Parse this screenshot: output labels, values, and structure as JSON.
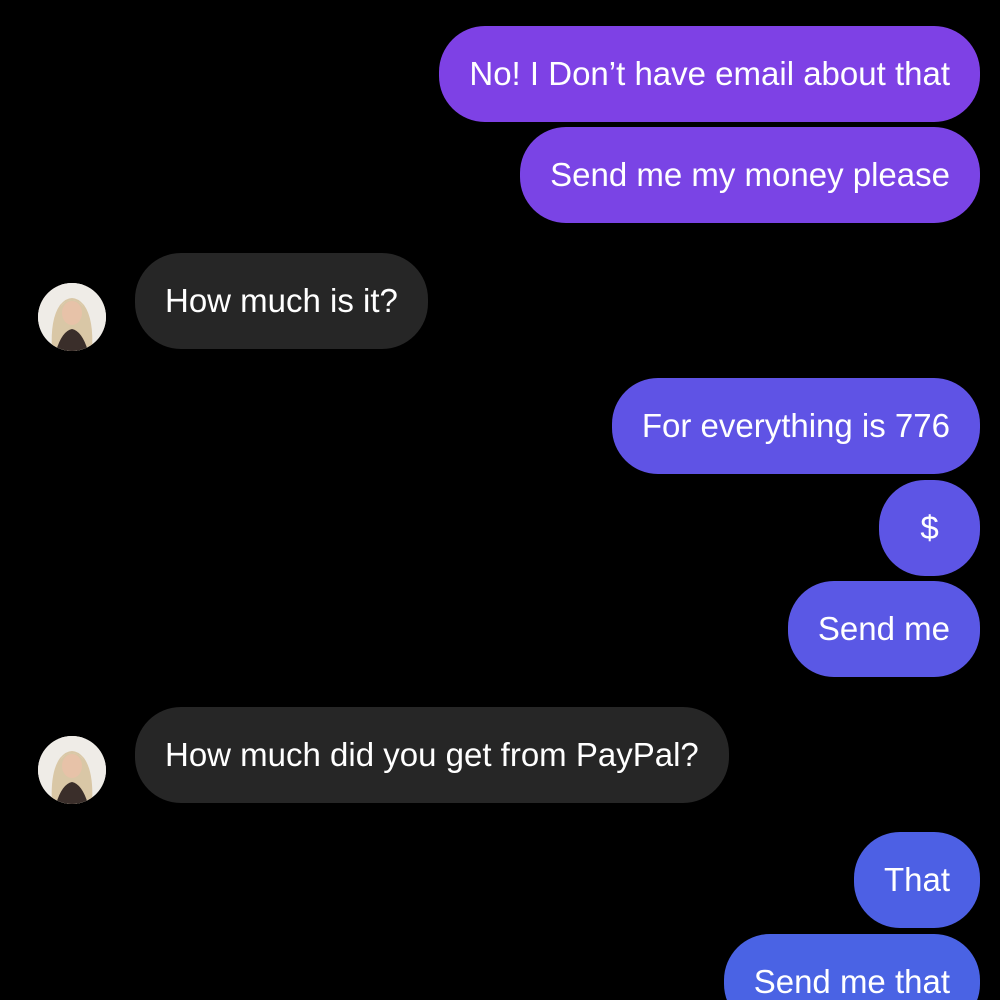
{
  "conversation": {
    "messages": [
      {
        "sender": "me",
        "text": "No! I Don’t have email about that"
      },
      {
        "sender": "me",
        "text": "Send me my money please"
      },
      {
        "sender": "contact",
        "text": "How much is it?"
      },
      {
        "sender": "me",
        "text": "For everything is 776"
      },
      {
        "sender": "me",
        "text": "$"
      },
      {
        "sender": "me",
        "text": "Send me"
      },
      {
        "sender": "contact",
        "text": "How much did you get from PayPal?"
      },
      {
        "sender": "me",
        "text": "That"
      },
      {
        "sender": "me",
        "text": "Send me that"
      }
    ]
  },
  "colors": {
    "background": "#000000",
    "incoming_bubble": "#262626",
    "outgoing_top": "#8040e6",
    "outgoing_bottom": "#4a62e4",
    "text": "#ffffff"
  }
}
